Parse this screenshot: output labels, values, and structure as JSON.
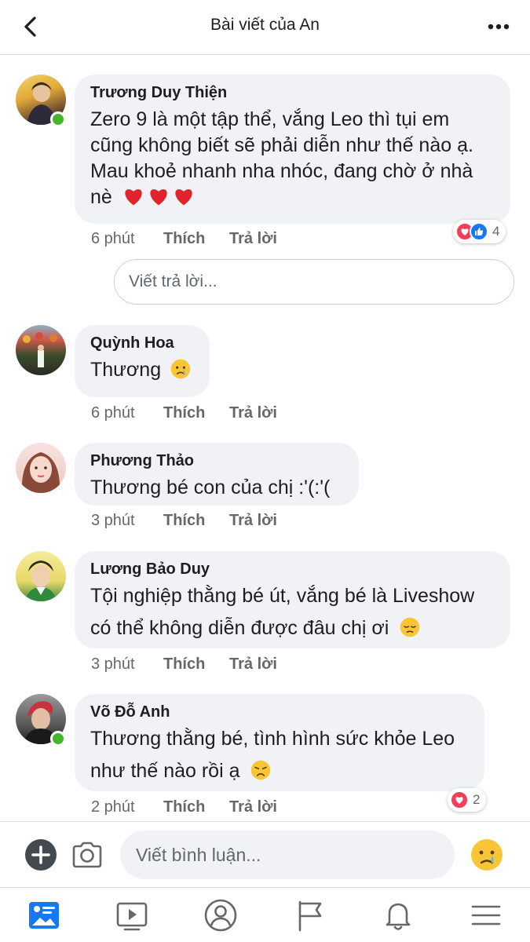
{
  "header": {
    "title": "Bài viết của An"
  },
  "comments": [
    {
      "name": "Trương Duy Thiện",
      "lines": [
        "Zero 9 là một tập thể, vắng Leo thì tụi em",
        "cũng không biết sẽ phải diễn như thế nào ạ.",
        "Mau khoẻ nhanh nha nhóc, đang chờ ở nhà",
        "nè"
      ],
      "time": "6 phút",
      "like": "Thích",
      "reply": "Trả lời",
      "reaction_count": "4"
    },
    {
      "name": "Quỳnh Hoa",
      "lines": [
        "Thương"
      ],
      "time": "6 phút",
      "like": "Thích",
      "reply": "Trả lời"
    },
    {
      "name": "Phương Thảo",
      "lines": [
        "Thương bé con của chị :'(:'("
      ],
      "time": "3 phút",
      "like": "Thích",
      "reply": "Trả lời"
    },
    {
      "name": "Lương Bảo Duy",
      "lines": [
        "Tội nghiệp thằng bé út, vắng bé là Liveshow",
        "có thể không diễn được đâu chị ơi"
      ],
      "time": "3 phút",
      "like": "Thích",
      "reply": "Trả lời"
    },
    {
      "name": "Võ Đỗ Anh",
      "lines": [
        "Thương thằng bé, tình hình sức khỏe Leo",
        "như thế nào rồi ạ"
      ],
      "time": "2 phút",
      "like": "Thích",
      "reply": "Trả lời",
      "reaction_count": "2"
    }
  ],
  "reply_input": {
    "placeholder": "Viết trả lời..."
  },
  "compose": {
    "placeholder": "Viết bình luận..."
  },
  "tabs": [
    "news-feed",
    "watch",
    "profile",
    "pages",
    "notifications",
    "menu"
  ],
  "colors": {
    "online": "#42b72a",
    "love": "#f33e58",
    "like": "#1877f2",
    "active_tab": "#1877f2"
  }
}
